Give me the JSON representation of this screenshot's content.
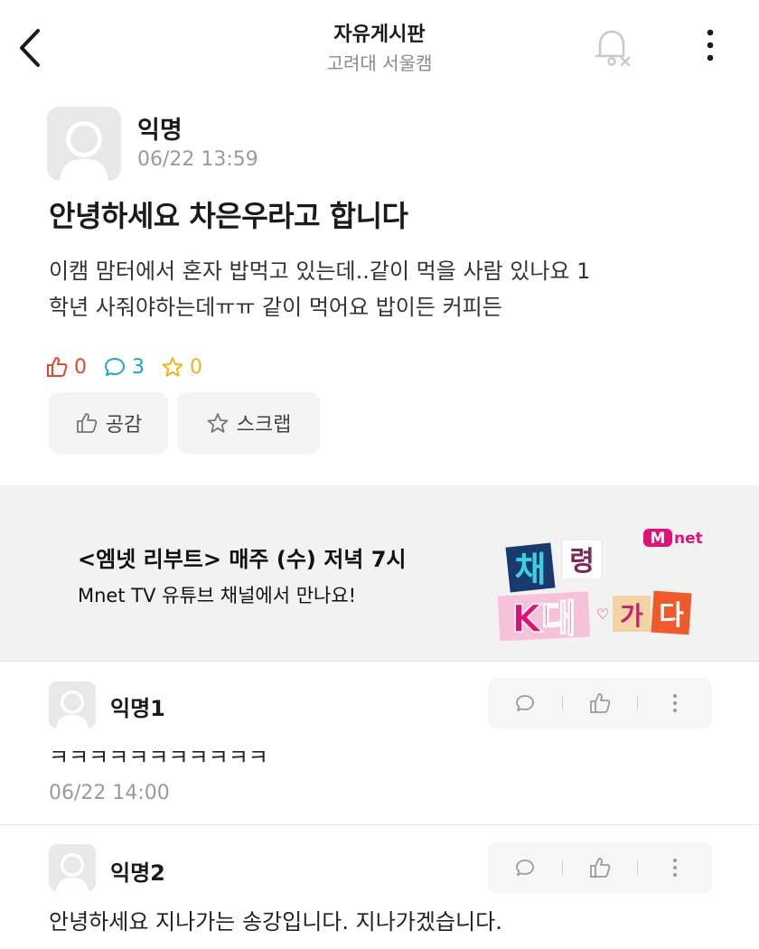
{
  "header": {
    "title": "자유게시판",
    "subtitle": "고려대 서울캠"
  },
  "post": {
    "author": "익명",
    "date": "06/22 13:59",
    "title": "안녕하세요 차은우라고 합니다",
    "body_line1": "이캠 맘터에서 혼자 밥먹고 있는데..같이 먹을 사람 있나요 1",
    "body_line2": "학년 사줘야하는데ㅠㅠ 같이 먹어요 밥이든 커피든",
    "likes": "0",
    "comments": "3",
    "scraps": "0",
    "like_button": "공감",
    "scrap_button": "스크랩"
  },
  "ad": {
    "line1": "<엠넷 리부트> 매주 (수) 저녁 7시",
    "line2": "Mnet TV 유튜브 채널에서 만나요!",
    "logo_m": "M",
    "logo_net": "net",
    "graphic_chars": [
      "채",
      "령",
      "K대",
      "가",
      "다"
    ]
  },
  "comments": [
    {
      "author": "익명1",
      "text": "ㅋㅋㅋㅋㅋㅋㅋㅋㅋㅋㅋ",
      "date": "06/22 14:00"
    },
    {
      "author": "익명2",
      "text": "안녕하세요 지나가는 송강입니다. 지나가겠습니다."
    }
  ],
  "colors": {
    "like": "#e8442b",
    "comment": "#1aa5c9",
    "scrap": "#f2b11c",
    "ad_bg": "#f2f2f2",
    "mnet": "#e0127a"
  }
}
